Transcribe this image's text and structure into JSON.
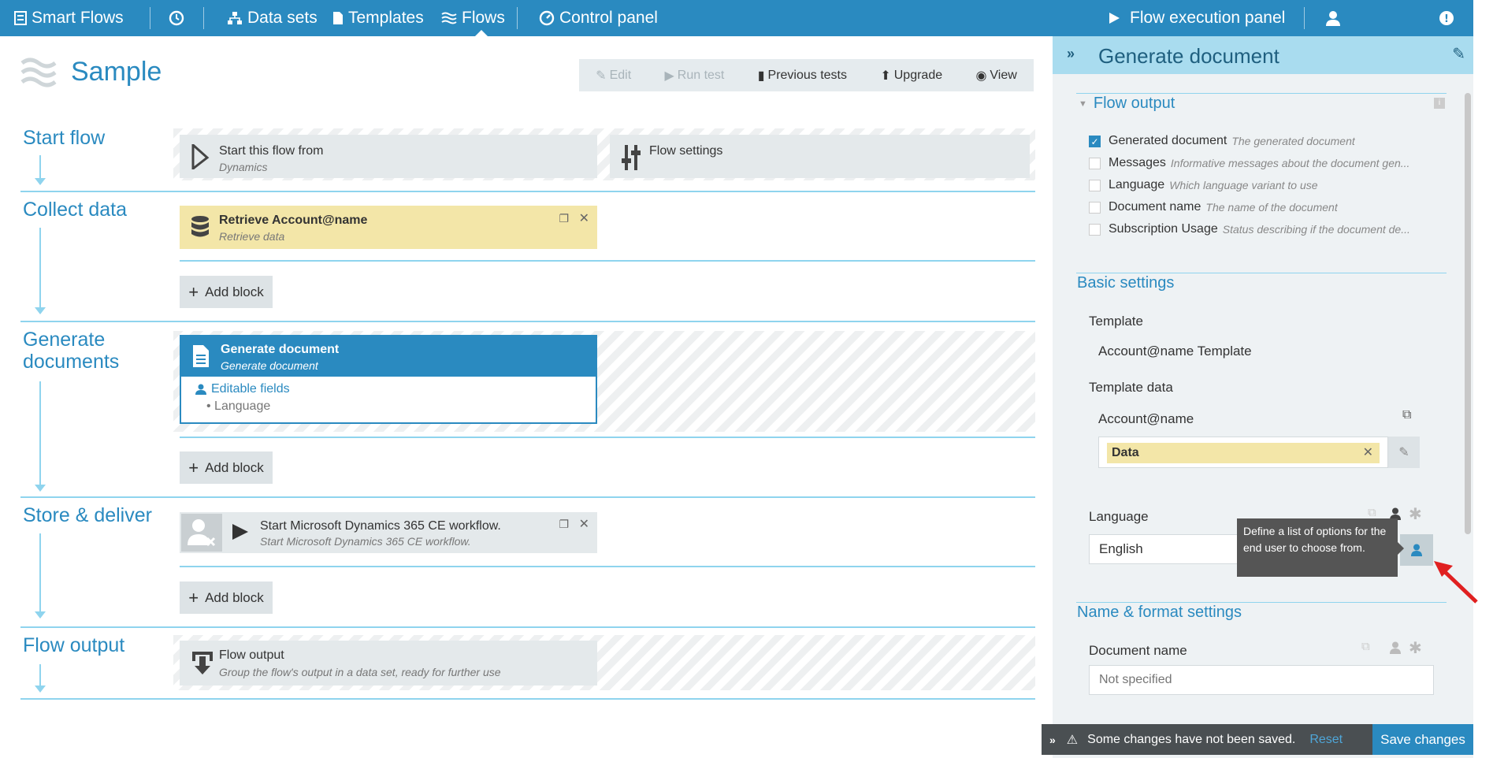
{
  "nav": {
    "brand": "Smart Flows",
    "datasets": "Data sets",
    "templates": "Templates",
    "flows": "Flows",
    "control_panel": "Control panel",
    "flow_execution": "Flow execution panel"
  },
  "page": {
    "title": "Sample"
  },
  "toolbar": {
    "edit": "Edit",
    "run_test": "Run test",
    "previous_tests": "Previous tests",
    "upgrade": "Upgrade",
    "view": "View"
  },
  "stages": {
    "start": "Start flow",
    "collect": "Collect data",
    "generate": "Generate documents",
    "store": "Store & deliver",
    "output": "Flow output"
  },
  "blocks": {
    "start_from": {
      "title": "Start this flow from",
      "sub": "Dynamics"
    },
    "flow_settings": {
      "title": "Flow settings"
    },
    "retrieve": {
      "title": "Retrieve Account@name",
      "sub": "Retrieve data"
    },
    "generate": {
      "title": "Generate document",
      "sub": "Generate document",
      "editable": "Editable fields",
      "field": "Language"
    },
    "workflow": {
      "title": "Start Microsoft Dynamics 365 CE workflow.",
      "sub": "Start Microsoft Dynamics 365 CE workflow."
    },
    "flow_output": {
      "title": "Flow output",
      "sub": "Group the flow's output in a data set, ready for further use"
    }
  },
  "add_block": "Add block",
  "panel": {
    "title": "Generate document",
    "flow_output_section": "Flow output",
    "outputs": [
      {
        "name": "Generated document",
        "desc": "The generated document",
        "checked": true
      },
      {
        "name": "Messages",
        "desc": "Informative messages about the document gen...",
        "checked": false
      },
      {
        "name": "Language",
        "desc": "Which language variant to use",
        "checked": false
      },
      {
        "name": "Document name",
        "desc": "The name of the document",
        "checked": false
      },
      {
        "name": "Subscription Usage",
        "desc": "Status describing if the document de...",
        "checked": false
      }
    ],
    "basic_settings": "Basic settings",
    "template_label": "Template",
    "template_value": "Account@name Template",
    "template_data_label": "Template data",
    "account_label": "Account@name",
    "data_chip": "Data",
    "language_label": "Language",
    "language_value": "English",
    "tooltip": "Define a list of options for the end user to choose from.",
    "name_format": "Name & format settings",
    "doc_name_label": "Document name",
    "doc_name_placeholder": "Not specified"
  },
  "status": {
    "message": "Some changes have not been saved.",
    "reset": "Reset",
    "save": "Save changes"
  },
  "colors": {
    "primary": "#2a8ac0",
    "block_yellow": "#f3e6a8",
    "stage_line": "#8fd4ee"
  }
}
